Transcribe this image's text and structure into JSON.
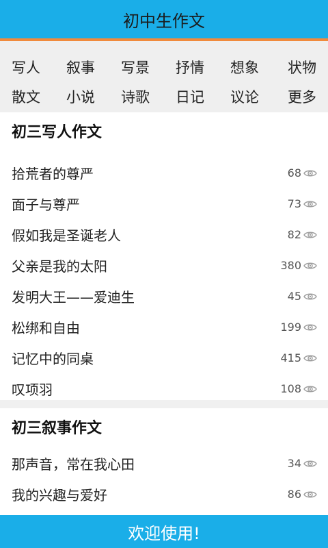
{
  "header": {
    "title": "初中生作文"
  },
  "categories": {
    "row1": [
      "写人",
      "叙事",
      "写景",
      "抒情",
      "想象",
      "状物"
    ],
    "row2": [
      "散文",
      "小说",
      "诗歌",
      "日记",
      "议论",
      "更多"
    ]
  },
  "sections": [
    {
      "title": "初三写人作文",
      "items": [
        {
          "title": "拾荒者的尊严",
          "views": "68"
        },
        {
          "title": "面子与尊严",
          "views": "73"
        },
        {
          "title": "假如我是圣诞老人",
          "views": "82"
        },
        {
          "title": "父亲是我的太阳",
          "views": "380"
        },
        {
          "title": "发明大王——爱迪生",
          "views": "45"
        },
        {
          "title": "松绑和自由",
          "views": "199"
        },
        {
          "title": "记忆中的同桌",
          "views": "415"
        },
        {
          "title": "叹项羽",
          "views": "108"
        }
      ]
    },
    {
      "title": "初三叙事作文",
      "items": [
        {
          "title": "那声音，常在我心田",
          "views": "34"
        },
        {
          "title": "我的兴趣与爱好",
          "views": "86"
        }
      ]
    }
  ],
  "footer": {
    "text": "欢迎使用!"
  },
  "colors": {
    "accent": "#1aaee8",
    "divider": "#f08a3c",
    "icon": "#9e9e9e"
  },
  "icons": {
    "view_count": "eye-icon"
  }
}
